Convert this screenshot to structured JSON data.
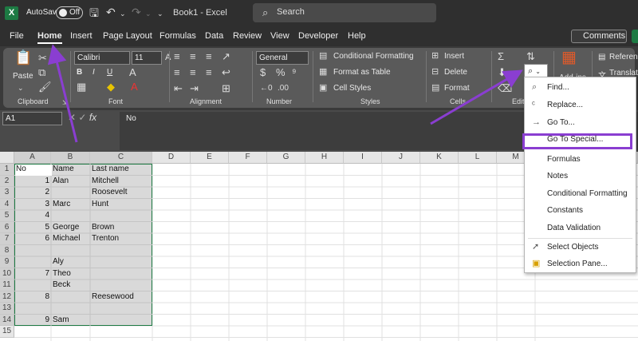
{
  "titlebar": {
    "autosave_label": "AutoSave",
    "autosave_state": "Off",
    "doc_title": "Book1  -  Excel",
    "search_placeholder": "Search"
  },
  "menu": {
    "items": [
      "File",
      "Home",
      "Insert",
      "Page Layout",
      "Formulas",
      "Data",
      "Review",
      "View",
      "Developer",
      "Help"
    ],
    "comments_label": "Comments"
  },
  "ribbon": {
    "clipboard": {
      "paste": "Paste",
      "group": "Clipboard"
    },
    "font": {
      "name": "Calibri",
      "size": "11",
      "group": "Font"
    },
    "alignment": {
      "group": "Alignment"
    },
    "number": {
      "format": "General",
      "group": "Number"
    },
    "styles": {
      "cond": "Conditional Formatting",
      "table": "Format as Table",
      "cell": "Cell Styles",
      "group": "Styles"
    },
    "cells": {
      "insert": "Insert",
      "delete": "Delete",
      "format": "Format",
      "group": "Cells"
    },
    "editing": {
      "group": "Editi"
    },
    "addins": {
      "label": "Add-ins",
      "ref": "Referenc",
      "translate": "Translato"
    }
  },
  "formula": {
    "namebox": "A1",
    "fx": "fx",
    "value": "No"
  },
  "grid": {
    "columns": [
      "A",
      "B",
      "C",
      "D",
      "E",
      "F",
      "G",
      "H",
      "I",
      "J",
      "K",
      "L",
      "M"
    ],
    "rows": [
      "1",
      "2",
      "3",
      "4",
      "5",
      "6",
      "7",
      "8",
      "9",
      "10",
      "11",
      "12",
      "13",
      "14",
      "15"
    ],
    "cells": {
      "a1": "No",
      "b1": "Name",
      "c1": "Last name",
      "a2": "1",
      "b2": "Alan",
      "c2": "Mitchell",
      "a3": "2",
      "c3": "Roosevelt",
      "a4": "3",
      "b4": "Marc",
      "c4": "Hunt",
      "a5": "4",
      "a6": "5",
      "b6": "George",
      "c6": "Brown",
      "a7": "6",
      "b7": "Michael",
      "c7": "Trenton",
      "b9": "Aly",
      "a10": "7",
      "b10": "Theo",
      "b11": "Beck",
      "a12": "8",
      "c12": "Reesewood",
      "a14": "9",
      "b14": "Sam"
    }
  },
  "dropdown": {
    "items": [
      "Find...",
      "Replace...",
      "Go To...",
      "Go To Special...",
      "Formulas",
      "Notes",
      "Conditional Formatting",
      "Constants",
      "Data Validation",
      "Select Objects",
      "Selection Pane..."
    ]
  },
  "colors": {
    "accent": "#8a3ed1",
    "excel_green": "#1d7a43"
  }
}
